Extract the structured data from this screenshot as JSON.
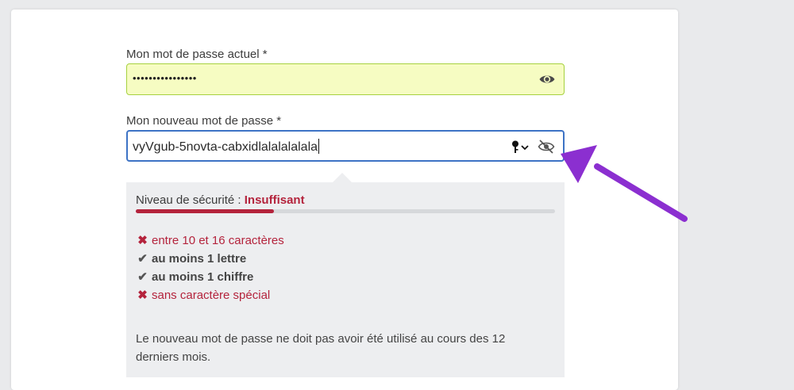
{
  "form": {
    "current_password": {
      "label": "Mon mot de passe actuel *",
      "masked_value": "••••••••••••••••",
      "toggle_icon": "eye-icon"
    },
    "new_password": {
      "label": "Mon nouveau mot de passe *",
      "value": "vyVgub-5novta-cabxidlalalalalala",
      "key_menu_icon": "key-chevron-icon",
      "toggle_icon": "eye-slash-icon"
    }
  },
  "strength": {
    "label": "Niveau de sécurité : ",
    "level": "Insuffisant",
    "progress": 0.33,
    "color": "#b4233c"
  },
  "rules": [
    {
      "text": "entre 10 et 16 caractères",
      "status": "fail",
      "icon": "x-icon"
    },
    {
      "text": "au moins 1 lettre",
      "status": "ok",
      "icon": "check-icon"
    },
    {
      "text": "au moins 1 chiffre",
      "status": "ok",
      "icon": "check-icon"
    },
    {
      "text": "sans caractère spécial",
      "status": "fail",
      "icon": "x-icon"
    }
  ],
  "note": "Le nouveau mot de passe ne doit pas avoir été utilisé au cours des 12 derniers mois.",
  "colors": {
    "accent_focus": "#3d73c5",
    "autofill_bg": "#f6fcc2",
    "autofill_border": "#a6d13f",
    "annotation_arrow": "#8b2fd0"
  }
}
